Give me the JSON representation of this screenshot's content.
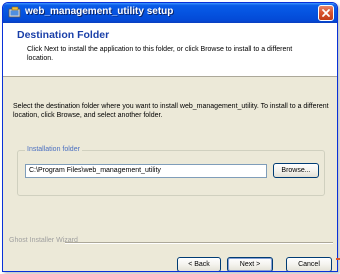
{
  "window": {
    "title": "web_management_utility setup"
  },
  "header": {
    "title": "Destination Folder",
    "description": "Click Next to install the application to this folder, or click Browse to install to a different location."
  },
  "main": {
    "instructions": "Select the destination folder where you want to install web_management_utility. To install to a different location, click Browse, and select another folder.",
    "group_label": "Installation folder",
    "folder_path": "C:\\Program Files\\web_management_utility",
    "browse_label": "Browse..."
  },
  "footer": {
    "brand": "Ghost Installer Wizard",
    "back_label": "< Back",
    "next_label": "Next >",
    "cancel_label": "Cancel"
  },
  "colors": {
    "titlebar": "#0553e0",
    "header_title": "#1a3fa8",
    "dialog_bg": "#ece9d8",
    "close_button": "#d95531"
  }
}
